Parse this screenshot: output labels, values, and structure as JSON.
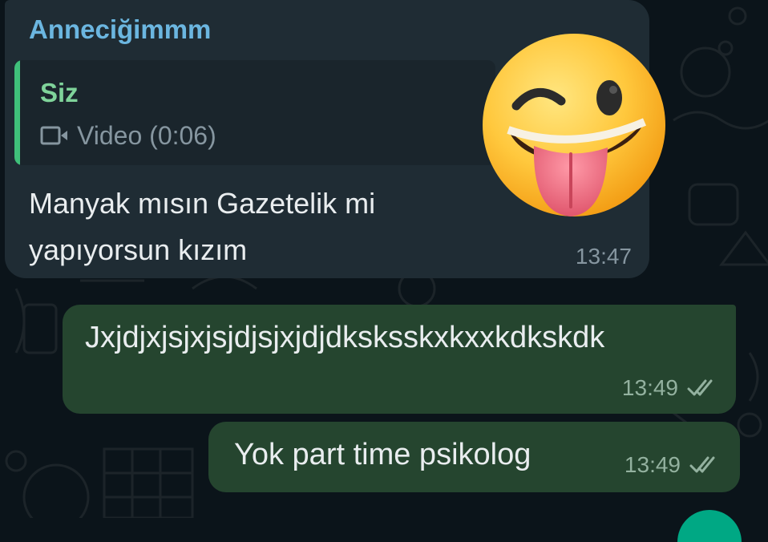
{
  "chat": {
    "incoming": {
      "sender": "Anneciğimmm",
      "quote": {
        "author": "Siz",
        "media_label": "Video (0:06)",
        "media_icon": "video-icon"
      },
      "text": "Manyak mısın Gazetelik mi yapıyorsun kızım",
      "time": "13:47",
      "sticker": "winking-face-with-tongue-emoji"
    },
    "outgoing": [
      {
        "text": "Jxjdjxjsjxjsjdjsjxjdjdksksskxkxxkdkskdk",
        "time": "13:49",
        "status_icon": "double-check-icon"
      },
      {
        "text": "Yok part time psikolog",
        "time": "13:49",
        "status_icon": "double-check-icon"
      }
    ]
  },
  "colors": {
    "background": "#0b141a",
    "incoming_bubble": "#1f2c34",
    "outgoing_bubble": "#25452f",
    "sender_name": "#6bb6e0",
    "quote_author": "#7fd39a",
    "quote_bar": "#3fc07a",
    "timestamp": "#8696a0"
  }
}
